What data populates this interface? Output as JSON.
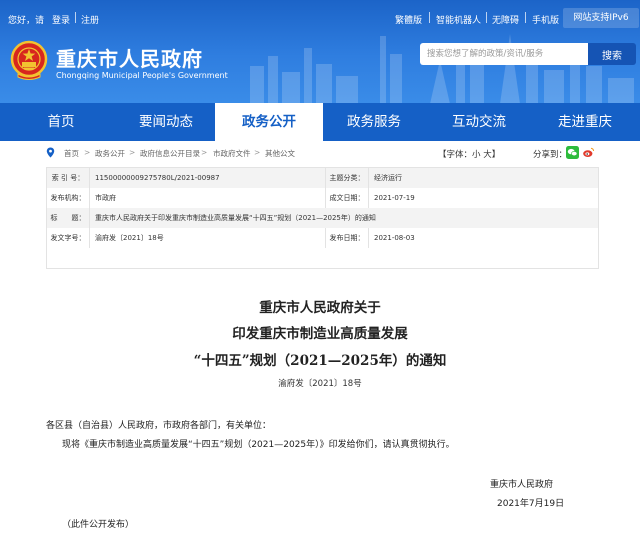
{
  "topbar": {
    "greeting": "您好，请",
    "login": "登录",
    "register": "注册",
    "traditional": "繁體版",
    "elderly": "智能机器人",
    "accessibility": "无障碍",
    "mobile": "手机版",
    "ipv6": "网站支持IPv6"
  },
  "header": {
    "site_name": "重庆市人民政府",
    "site_name_en": "Chongqing Municipal People's Government",
    "search_placeholder": "搜索您想了解的政策/资讯/服务",
    "search_button": "搜索"
  },
  "nav": {
    "items": [
      {
        "label": "首页"
      },
      {
        "label": "要闻动态"
      },
      {
        "label": "政务公开"
      },
      {
        "label": "政务服务"
      },
      {
        "label": "互动交流"
      },
      {
        "label": "走进重庆"
      }
    ],
    "active": "政务公开"
  },
  "breadcrumb": {
    "items": [
      "首页",
      "政务公开",
      "政府信息公开目录",
      "市政府文件",
      "其他公文"
    ],
    "separator": ">"
  },
  "tools": {
    "font_label": "【字体：",
    "font_small": "小",
    "font_large": "大",
    "font_end": "】",
    "share_label": "分享到："
  },
  "info": {
    "index_label": "索 引 号：",
    "index_value": "11500000009275780L/2021-00987",
    "topic_label": "主题分类：",
    "topic_value": "经济运行",
    "issuer_label": "发布机构：",
    "issuer_value": "市政府",
    "date_label": "成文日期：",
    "date_value": "2021-07-19",
    "title_label": "标　　题：",
    "title_value": "重庆市人民政府关于印发重庆市制造业高质量发展“十四五”规划（2021—2025年）的通知",
    "docno_label": "发文字号：",
    "docno_value": "渝府发〔2021〕18号",
    "pubdate_label": "发布日期：",
    "pubdate_value": "2021-08-03"
  },
  "article": {
    "title_line1": "重庆市人民政府关于",
    "title_line2": "印发重庆市制造业高质量发展",
    "title_line3": "“十四五”规划（2021—2025年）的通知",
    "doc_number": "渝府发〔2021〕18号",
    "salutation": "各区县（自治县）人民政府，市政府各部门，有关单位：",
    "body": "现将《重庆市制造业高质量发展“十四五”规划（2021—2025年）》印发给你们，请认真贯彻执行。",
    "signature": "重庆市人民政府",
    "date": "2021年7月19日",
    "note": "（此件公开发布）"
  },
  "colors": {
    "header_blue": "#2f7ee0",
    "nav_blue": "#1560c6",
    "search_button": "#1554b4",
    "wechat_green": "#2dbb3c",
    "weibo_red": "#e03a2c"
  }
}
